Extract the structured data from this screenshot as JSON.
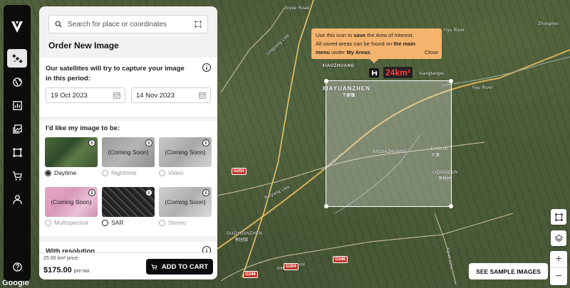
{
  "map": {
    "tooltip": {
      "line1_pre": "Use this icon to ",
      "line1_bold": "save",
      "line1_post": " the Area of Interest.",
      "line2_pre": "All saved areas can be found on ",
      "line2_bold": "the main",
      "line3_bold1": "menu",
      "line3_mid": " under ",
      "line3_bold2": "My Areas",
      "line3_post": ".",
      "close_label": "Close"
    },
    "aoi_area": "24km²",
    "places": {
      "xiaozhuang": "XIAOZHUANG",
      "xiayuanzhen": "XIAYUANZHEN",
      "xiayuanzhen_cn": "下原镇",
      "xiujiazhuang": "XIUJIAZHUANG",
      "dagun": "DAGUN",
      "dagun_cn": "大滚",
      "liqiaocun": "LIQIAOCUN",
      "liqiaocun_cn": "李桥村",
      "xiangtangle": "Xiangtangle",
      "yiyu_river": "Yiyu River",
      "yiyu_river2": "Yiyu River",
      "zhongmei": "Zhongmei",
      "guoyuanzhen": "GUOYUANZHEN",
      "guoyuanzhen_cn": "郭园镇",
      "ruiyang_line": "Ruiyang Line",
      "ruiyang_line2": "Ruiyang Line",
      "lingyang_line": "Lingyang Line",
      "jiaoyuan_line": "Jiaoyuan Line",
      "xiyue_line": "Xiyue Line",
      "shield_g204": "G204",
      "shield_g204b": "G204",
      "shield_g346": "G346",
      "shield_g346b": "G346"
    },
    "google": "Google"
  },
  "panel": {
    "search_placeholder": "Search for place or coordinates",
    "title": "Order New Image",
    "period_text": "Our satellites will try to capture your image in this period:",
    "start_date": "19 Oct 2023",
    "end_date": "14 Nov 2023",
    "image_type_text": "I'd like my image to be:",
    "options": [
      {
        "label": "Daytime",
        "overlay": ""
      },
      {
        "label": "Nighttime",
        "overlay": "(Coming Soon)"
      },
      {
        "label": "Video",
        "overlay": "(Coming Soon)"
      },
      {
        "label": "Multispectral",
        "overlay": "(Coming Soon)"
      },
      {
        "label": "SAR",
        "overlay": ""
      },
      {
        "label": "Stereo",
        "overlay": "(Coming Soon)"
      }
    ],
    "resolution_text": "With resolution",
    "price_label": "25.00 km² price:",
    "price": "$175.00",
    "pretax": "pre-tax",
    "cart_button": "ADD TO CART"
  },
  "controls": {
    "sample_button": "SEE SAMPLE IMAGES",
    "zoom_in": "+",
    "zoom_out": "−"
  }
}
